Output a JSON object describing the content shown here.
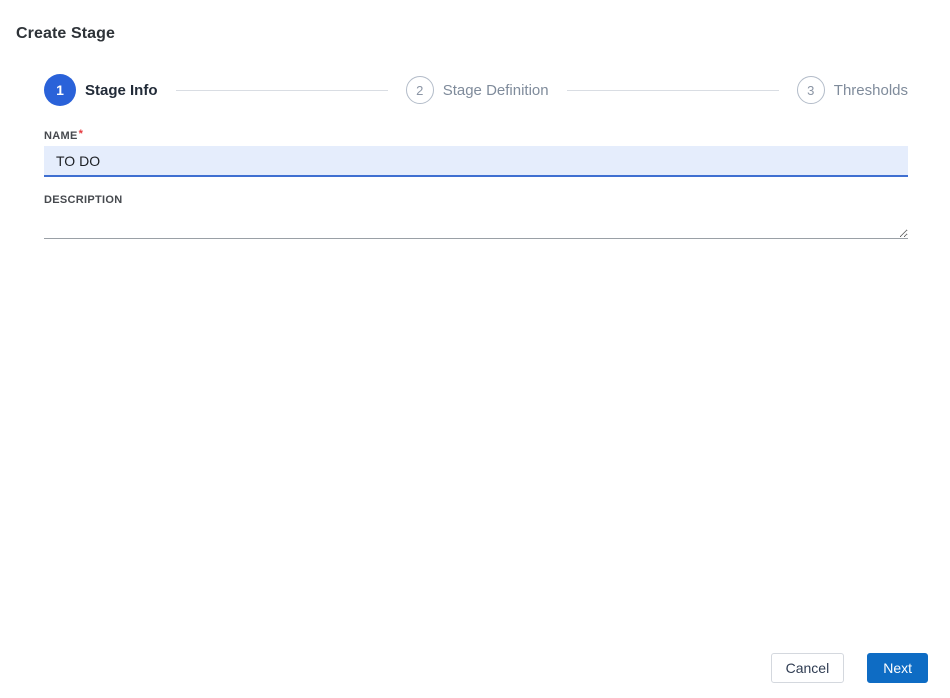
{
  "dialog": {
    "title": "Create Stage"
  },
  "stepper": {
    "steps": [
      {
        "number": "1",
        "label": "Stage Info",
        "state": "active"
      },
      {
        "number": "2",
        "label": "Stage Definition",
        "state": "inactive"
      },
      {
        "number": "3",
        "label": "Thresholds",
        "state": "inactive"
      }
    ]
  },
  "form": {
    "name": {
      "label": "NAME",
      "required_marker": "*",
      "value": "TO DO",
      "placeholder": ""
    },
    "description": {
      "label": "DESCRIPTION",
      "value": "",
      "placeholder": ""
    }
  },
  "footer": {
    "cancel_label": "Cancel",
    "next_label": "Next"
  },
  "colors": {
    "active_step_blue": "#2a62d9",
    "next_button_blue": "#0e6cc4",
    "input_focus_background": "#e5edfc",
    "input_focus_underline": "#3f6fd1",
    "required_red": "#e5393e",
    "inactive_step_gray": "#7f8b9b",
    "connector_gray": "#d9dde3"
  }
}
